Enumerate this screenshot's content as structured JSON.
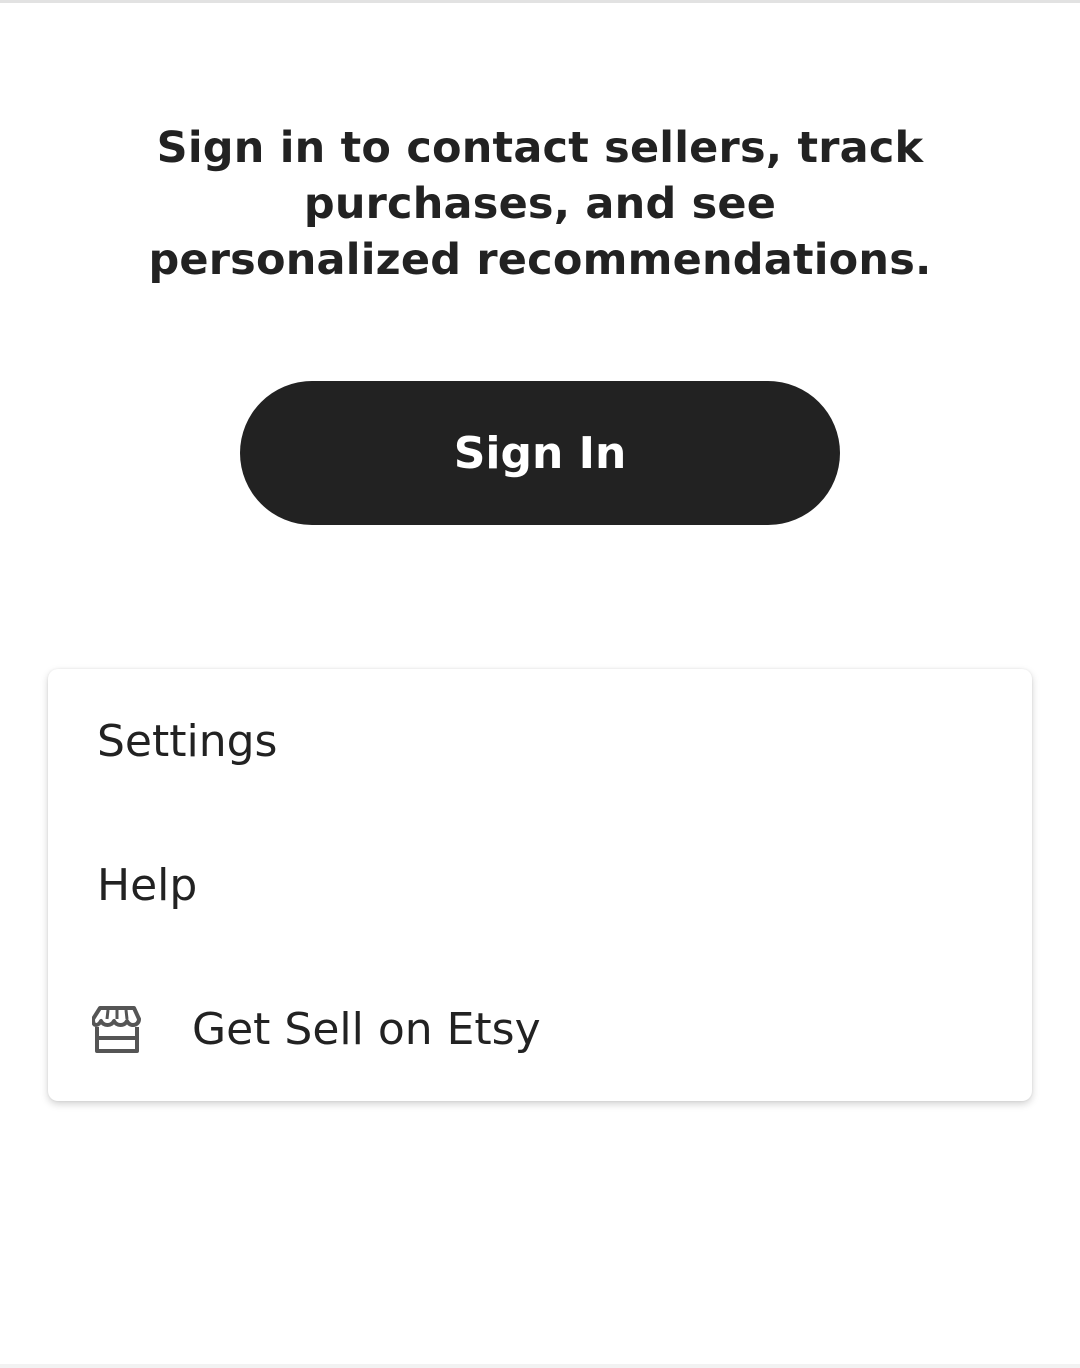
{
  "intro": {
    "message": "Sign in to contact sellers, track purchases, and see personalized recommendations."
  },
  "sign_in": {
    "label": "Sign In"
  },
  "menu": {
    "items": [
      {
        "label": "Settings",
        "icon": ""
      },
      {
        "label": "Help",
        "icon": ""
      },
      {
        "label": "Get Sell on Etsy",
        "icon": "shop-icon"
      }
    ]
  },
  "colors": {
    "button_bg": "#222222",
    "button_text": "#ffffff",
    "text": "#222222",
    "background": "#ffffff"
  }
}
